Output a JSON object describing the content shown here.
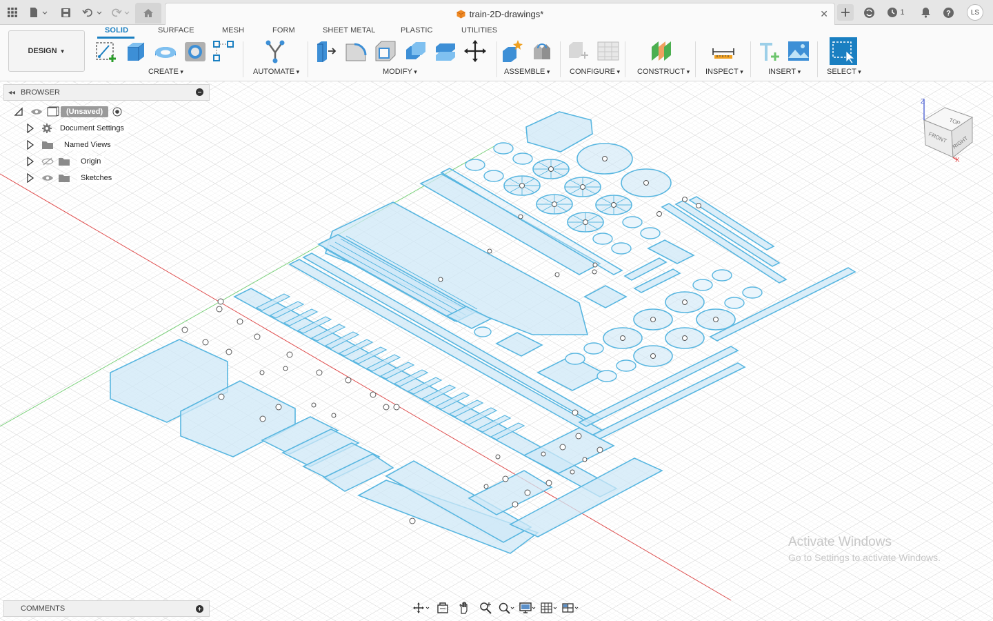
{
  "window": {
    "document_title": "train-2D-drawings*",
    "avatar_initials": "LS",
    "job_count": "1"
  },
  "workspace": {
    "design_label": "DESIGN"
  },
  "ribbon": {
    "tabs": [
      {
        "label": "SOLID",
        "active": true
      },
      {
        "label": "SURFACE"
      },
      {
        "label": "MESH"
      },
      {
        "label": "FORM"
      },
      {
        "label": "SHEET METAL"
      },
      {
        "label": "PLASTIC"
      },
      {
        "label": "UTILITIES"
      }
    ],
    "groups": {
      "create": "CREATE",
      "automate": "AUTOMATE",
      "modify": "MODIFY",
      "assemble": "ASSEMBLE",
      "configure": "CONFIGURE",
      "construct": "CONSTRUCT",
      "inspect": "INSPECT",
      "insert": "INSERT",
      "select": "SELECT"
    }
  },
  "browser": {
    "title": "BROWSER",
    "root": "(Unsaved)",
    "items": [
      {
        "label": "Document Settings",
        "icon": "gear-icon"
      },
      {
        "label": "Named Views",
        "icon": "folder-icon"
      },
      {
        "label": "Origin",
        "icon": "folder-icon",
        "visibility": "hidden"
      },
      {
        "label": "Sketches",
        "icon": "folder-icon",
        "visibility": "visible"
      }
    ]
  },
  "comments": {
    "title": "COMMENTS"
  },
  "viewcube": {
    "top": "TOP",
    "front": "FRONT",
    "right": "RIGHT",
    "axis_x": "X",
    "axis_z": "Z"
  },
  "watermark": {
    "line1": "Activate Windows",
    "line2": "Go to Settings to activate Windows."
  },
  "colors": {
    "accent": "#1a7fc1",
    "sketch_stroke": "#58b6e0",
    "sketch_fill": "#cfe8f7",
    "x_axis": "#e05050",
    "y_axis": "#7ad07a"
  }
}
